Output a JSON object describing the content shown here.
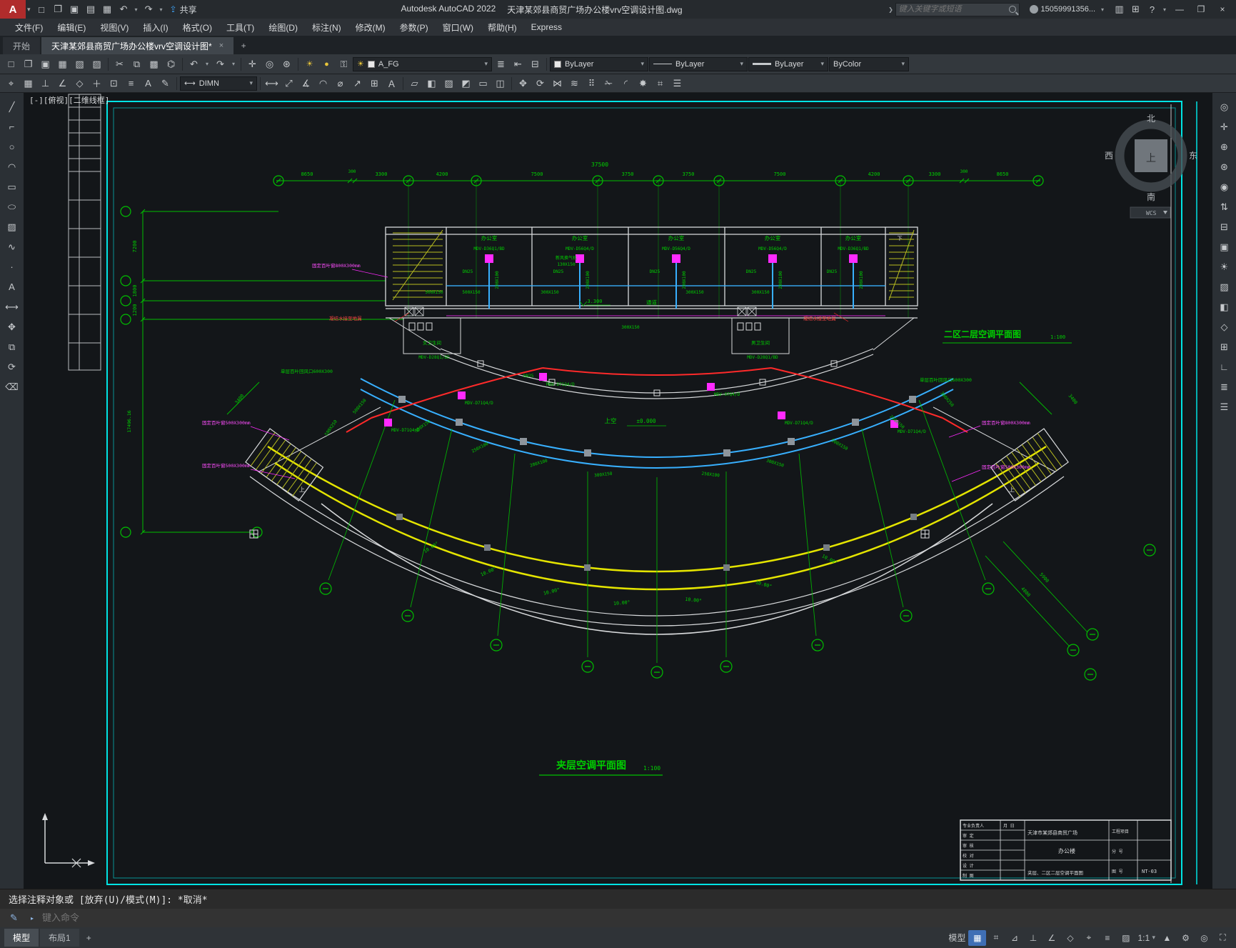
{
  "titlebar": {
    "app": "Autodesk AutoCAD 2022",
    "doc": "天津某郊县商贸广场办公楼vrv空调设计图.dwg",
    "share": "共享",
    "search_placeholder": "键入关键字或短语",
    "account": "15059991356...",
    "help": "?"
  },
  "menubar": {
    "items": [
      "文件(F)",
      "编辑(E)",
      "视图(V)",
      "插入(I)",
      "格式(O)",
      "工具(T)",
      "绘图(D)",
      "标注(N)",
      "修改(M)",
      "参数(P)",
      "窗口(W)",
      "帮助(H)",
      "Express"
    ]
  },
  "tabbar": {
    "start": "开始",
    "doc_tab": "天津某郊县商贸广场办公楼vrv空调设计图*",
    "new_tab": "+"
  },
  "toolbars": {
    "layer": "A_FG",
    "color": "ByLayer",
    "linetype": "ByLayer",
    "lineweight": "ByLayer",
    "plotstyle": "ByColor",
    "dimstyle": "DIMN"
  },
  "viewport": {
    "label": "[-][俯视][二维线框]"
  },
  "viewcube": {
    "n": "北",
    "s": "南",
    "w": "西",
    "e": "东",
    "top": "上",
    "wcs": "WCS"
  },
  "cmd": {
    "history": "选择注释对象或 [放弃(U)/模式(M)]: *取消*",
    "placeholder": "键入命令"
  },
  "statusbar": {
    "model": "模型",
    "layout1": "布局1",
    "add": "+",
    "scale": "1:1"
  },
  "drawing": {
    "title_main": "二区二层空调平面图",
    "scale_main": "1:100",
    "title_sub": "夹层空调平面图",
    "scale_sub": "1:100",
    "total_dim": "37500",
    "top_dims": [
      "8650",
      "300",
      "3300",
      "4200",
      "7500",
      "3750",
      "3750",
      "7500",
      "4200",
      "3300",
      "300",
      "8650"
    ],
    "left_dims": [
      "7200",
      "1800",
      "1200",
      "17496.16"
    ],
    "side_dims": [
      "3400",
      "3400",
      "4800",
      "5900"
    ],
    "rooms": [
      "办公室",
      "办公室",
      "办公室",
      "办公室",
      "办公室"
    ],
    "corridor": "通道",
    "wc_left": "女卫生间",
    "wc_right": "男卫生间",
    "level_band": "3.300",
    "level_center": "±0.000",
    "void_label": "上空",
    "stair_up": "上",
    "stair_down": "下",
    "units_band": [
      "MDV-D36Q1/BD",
      "MDV-D56Q4/D",
      "MDV-D56Q4/D",
      "MDV-D56Q4/D",
      "MDV-D36Q1/BD"
    ],
    "units_fan": [
      "MDV-D71Q4/D",
      "MDV-D71Q4/D",
      "MDV-D71Q4/D",
      "MDV-97Q4/D",
      "MDV-D71Q4/D",
      "MDV-D71Q4/D"
    ],
    "units_wc": [
      "MDV-D28Q1/BD",
      "MDV-D28Q1/BD"
    ],
    "risers": [
      "200X100",
      "200X100",
      "200X100",
      "200X100",
      "200X100"
    ],
    "band_ducts": [
      "500X150",
      "500X150",
      "300X150",
      "300X150",
      "300X150"
    ],
    "fan_ducts": [
      "500X250",
      "500X150",
      "300X150",
      "250X100",
      "280X100",
      "300X150",
      "250X100",
      "300X150",
      "500X150",
      "250X150",
      "300X250"
    ],
    "center_duct": "300X150",
    "dn_labels": [
      "DN25",
      "DN25",
      "DN25",
      "DN25",
      "DN25",
      "DN25"
    ],
    "equip": "新风换气机",
    "equip_size": "130X150",
    "angles": [
      "10.00°",
      "10.00°",
      "10.00°",
      "10.00°",
      "10.00°",
      "10.00°",
      "10.00°"
    ],
    "notes_magenta": [
      "固定百叶窗800X300mm",
      "固定百叶窗500X300mm",
      "固定百叶窗500X300mm",
      "固定百叶窗800X300mm",
      "固定百叶窗500X300mm"
    ],
    "notes_green": [
      "单层百叶回风口600X300",
      "单层百叶回风口600X300"
    ],
    "notes_red": [
      "凝结水接至地漏",
      "凝结水接至地漏"
    ]
  },
  "titleblock": {
    "rows": [
      "专业负责人",
      "审 定",
      "审 核",
      "校 对",
      "设 计",
      "制 图"
    ],
    "date": "月 日",
    "project": "天津市某郊县商贸广场",
    "item_label": "工程项目",
    "building": "办公楼",
    "sheet_name": "夹层、二区二层空调平面图",
    "sub_label": "分 号",
    "no_label": "图 号",
    "sheet_no": "NT-03"
  }
}
